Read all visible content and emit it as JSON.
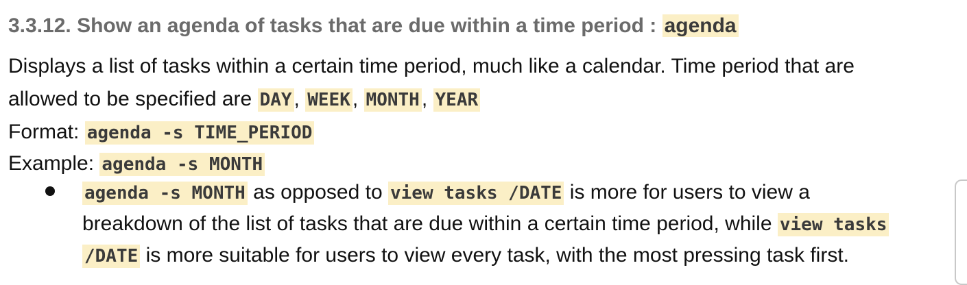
{
  "heading": {
    "text": "3.3.12. Show an agenda of tasks that are due within a time period :",
    "command": "agenda"
  },
  "description": {
    "line1": "Displays a list of tasks within a certain time period, much like a calendar. Time period that are",
    "line2_prefix": "allowed to be specified are",
    "periods": [
      "DAY",
      "WEEK",
      "MONTH",
      "YEAR"
    ],
    "sep": ","
  },
  "format": {
    "label": "Format:",
    "value": "agenda -s TIME_PERIOD"
  },
  "example": {
    "label": "Example:",
    "value": "agenda -s MONTH"
  },
  "bullet": {
    "code1": "agenda -s MONTH",
    "text1": "as opposed to",
    "code2": "view tasks /DATE",
    "text2": "is more for users to view a",
    "text3": "breakdown of the list of tasks that are due within a certain time period, while",
    "code3a": "view tasks",
    "code3b": "/DATE",
    "text4": "is more suitable for users to view every task, with the most pressing task first."
  }
}
